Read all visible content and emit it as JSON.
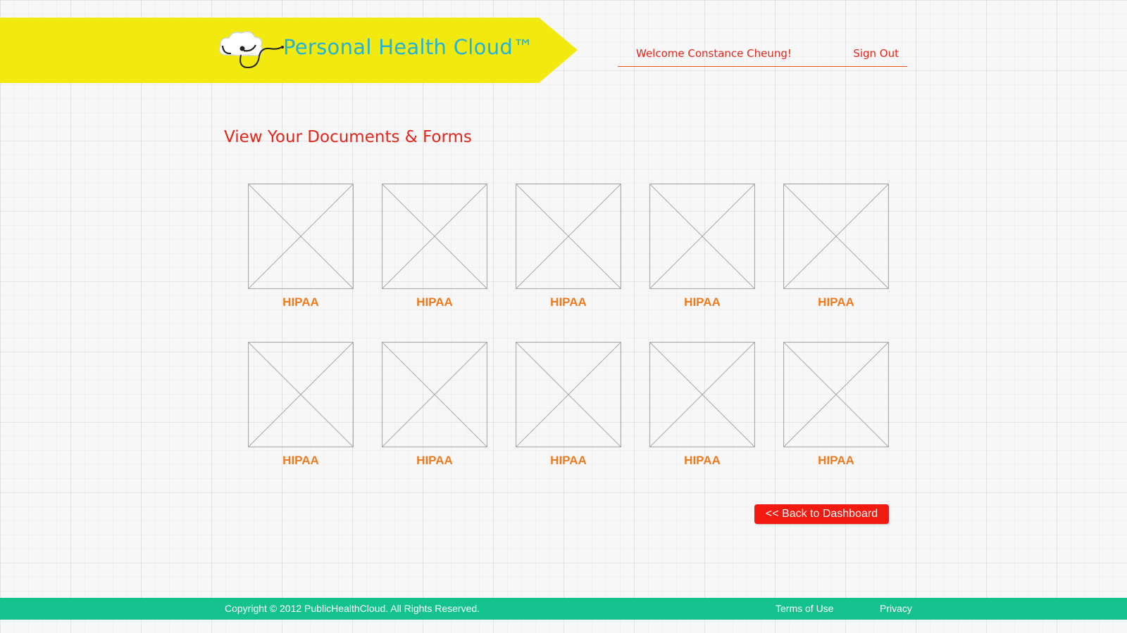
{
  "header": {
    "app_title": "Personal Health Cloud™",
    "logo_icon": "cloud-stethoscope-icon",
    "welcome_text": "Welcome Constance Cheung!",
    "sign_out_label": "Sign Out"
  },
  "main": {
    "title": "View Your Documents & Forms",
    "documents": [
      {
        "label": "HIPAA",
        "thumbnail_icon": "image-placeholder-icon"
      },
      {
        "label": "HIPAA",
        "thumbnail_icon": "image-placeholder-icon"
      },
      {
        "label": "HIPAA",
        "thumbnail_icon": "image-placeholder-icon"
      },
      {
        "label": "HIPAA",
        "thumbnail_icon": "image-placeholder-icon"
      },
      {
        "label": "HIPAA",
        "thumbnail_icon": "image-placeholder-icon"
      },
      {
        "label": "HIPAA",
        "thumbnail_icon": "image-placeholder-icon"
      },
      {
        "label": "HIPAA",
        "thumbnail_icon": "image-placeholder-icon"
      },
      {
        "label": "HIPAA",
        "thumbnail_icon": "image-placeholder-icon"
      },
      {
        "label": "HIPAA",
        "thumbnail_icon": "image-placeholder-icon"
      },
      {
        "label": "HIPAA",
        "thumbnail_icon": "image-placeholder-icon"
      }
    ],
    "back_button_label": "<< Back to Dashboard"
  },
  "footer": {
    "copyright": "Copyright © 2012 PublicHealthCloud. All Rights Reserved.",
    "terms_label": "Terms of Use",
    "privacy_label": "Privacy"
  },
  "colors": {
    "banner_yellow": "#f2e90f",
    "title_blue": "#22b3d6",
    "accent_red": "#e2261c",
    "label_orange": "#f07a1e",
    "button_red": "#f01a10",
    "footer_green": "#14c28e"
  }
}
